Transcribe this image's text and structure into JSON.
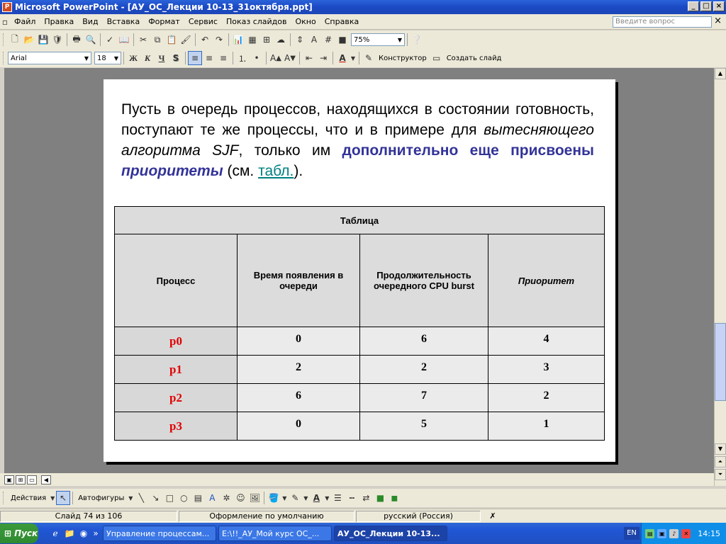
{
  "window": {
    "title": "Microsoft PowerPoint - [АУ_ОС_Лекции 10-13_31октября.ppt]"
  },
  "menu": {
    "items": [
      "Файл",
      "Правка",
      "Вид",
      "Вставка",
      "Формат",
      "Сервис",
      "Показ слайдов",
      "Окно",
      "Справка"
    ],
    "ask_placeholder": "Введите вопрос"
  },
  "toolbar": {
    "zoom": "75%",
    "font": "Arial",
    "size": "18",
    "bold": "Ж",
    "italic": "К",
    "underline": "Ч",
    "shadow": "S",
    "designer": "Конструктор",
    "new_slide": "Создать слайд"
  },
  "slide": {
    "text_1": "Пусть в очередь процессов, находящихся в состоянии готовность, поступают те же процессы, что и в примере для ",
    "text_italic": "вытесняющего алгоритма SJF",
    "text_2": ", только им ",
    "text_blue": "дополнительно еще присвоены ",
    "text_blue_italic": "приоритеты",
    "text_3": " (см. ",
    "text_link": "табл.",
    "text_4": ").",
    "table": {
      "caption": "Таблица",
      "headers": [
        "Процесс",
        "Время появления в очереди",
        "Продолжительность очередного CPU burst",
        "Приоритет"
      ],
      "rows": [
        [
          "p0",
          "0",
          "6",
          "4"
        ],
        [
          "p1",
          "2",
          "2",
          "3"
        ],
        [
          "p2",
          "6",
          "7",
          "2"
        ],
        [
          "p3",
          "0",
          "5",
          "1"
        ]
      ]
    }
  },
  "drawing": {
    "actions": "Действия",
    "autoshapes": "Автофигуры"
  },
  "status": {
    "slide": "Слайд 74 из 106",
    "design": "Оформление по умолчанию",
    "language": "русский (Россия)"
  },
  "taskbar": {
    "start": "Пуск",
    "tasks": [
      "Управление процессам...",
      "E:\\!!_АУ_Мой курс ОС_...",
      "АУ_ОС_Лекции 10-13..."
    ],
    "lang": "EN",
    "clock": "14:15"
  }
}
